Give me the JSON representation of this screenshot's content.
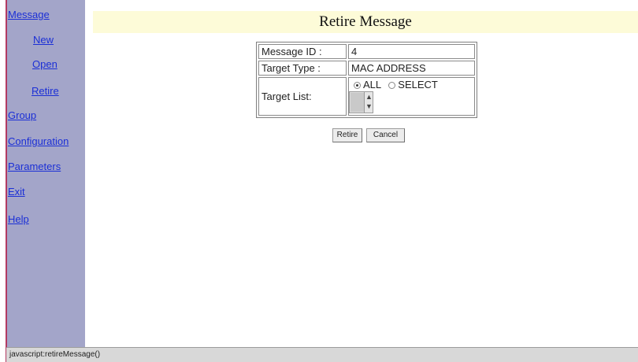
{
  "sidebar": {
    "items": [
      {
        "label": "Message"
      },
      {
        "label": "New"
      },
      {
        "label": "Open"
      },
      {
        "label": "Retire"
      },
      {
        "label": "Group"
      },
      {
        "label": "Configuration"
      },
      {
        "label": "Parameters"
      },
      {
        "label": "Exit"
      },
      {
        "label": "Help"
      }
    ]
  },
  "main": {
    "title": "Retire Message"
  },
  "form": {
    "message_id_label": "Message ID :",
    "message_id_value": "4",
    "target_type_label": "Target Type :",
    "target_type_value": "MAC ADDRESS",
    "target_list_label": "Target List:",
    "radio_all_label": "ALL",
    "radio_select_label": "SELECT",
    "selected_option": "ALL"
  },
  "buttons": {
    "retire_label": "Retire",
    "cancel_label": "Cancel"
  },
  "status_bar": {
    "text": "javascript:retireMessage()"
  },
  "colors": {
    "sidebar_bg": "#a3a5c9",
    "link": "#1b2fd6",
    "title_bar_bg": "#fdfbd8",
    "left_accent": "#b23a62"
  }
}
